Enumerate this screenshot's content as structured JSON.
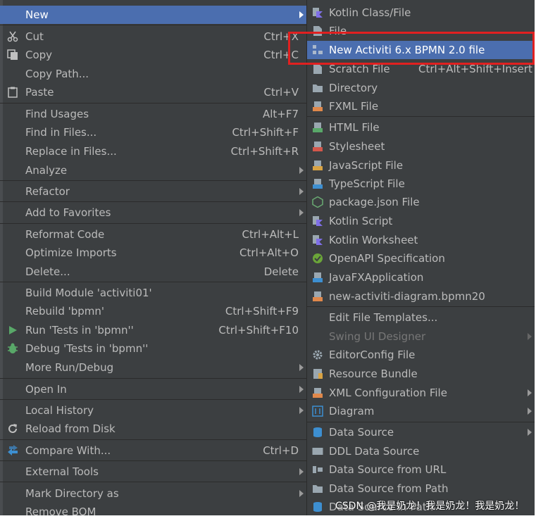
{
  "left_menu": [
    {
      "label": "New",
      "shortcut": "",
      "submenu": true,
      "highlight": true,
      "icon": ""
    },
    {
      "label": "Cut",
      "shortcut": "Ctrl+X",
      "icon": "scissors-icon"
    },
    {
      "label": "Copy",
      "shortcut": "Ctrl+C",
      "icon": "copy-icon"
    },
    {
      "label": "Copy Path...",
      "shortcut": "",
      "icon": ""
    },
    {
      "label": "Paste",
      "shortcut": "Ctrl+V",
      "icon": "clipboard-icon"
    },
    {
      "label": "Find Usages",
      "shortcut": "Alt+F7",
      "icon": ""
    },
    {
      "label": "Find in Files...",
      "shortcut": "Ctrl+Shift+F",
      "icon": ""
    },
    {
      "label": "Replace in Files...",
      "shortcut": "Ctrl+Shift+R",
      "icon": ""
    },
    {
      "label": "Analyze",
      "shortcut": "",
      "submenu": true,
      "icon": ""
    },
    {
      "label": "Refactor",
      "shortcut": "",
      "submenu": true,
      "icon": ""
    },
    {
      "label": "Add to Favorites",
      "shortcut": "",
      "submenu": true,
      "icon": ""
    },
    {
      "label": "Reformat Code",
      "shortcut": "Ctrl+Alt+L",
      "icon": ""
    },
    {
      "label": "Optimize Imports",
      "shortcut": "Ctrl+Alt+O",
      "icon": ""
    },
    {
      "label": "Delete...",
      "shortcut": "Delete",
      "icon": ""
    },
    {
      "label": "Build Module 'activiti01'",
      "shortcut": "",
      "icon": ""
    },
    {
      "label": "Rebuild 'bpmn'",
      "shortcut": "Ctrl+Shift+F9",
      "icon": ""
    },
    {
      "label": "Run 'Tests in 'bpmn''",
      "shortcut": "Ctrl+Shift+F10",
      "icon": "run-icon"
    },
    {
      "label": "Debug 'Tests in 'bpmn''",
      "shortcut": "",
      "icon": "debug-icon"
    },
    {
      "label": "More Run/Debug",
      "shortcut": "",
      "submenu": true,
      "icon": ""
    },
    {
      "label": "Open In",
      "shortcut": "",
      "submenu": true,
      "icon": ""
    },
    {
      "label": "Local History",
      "shortcut": "",
      "submenu": true,
      "icon": ""
    },
    {
      "label": "Reload from Disk",
      "shortcut": "",
      "icon": "reload-icon"
    },
    {
      "label": "Compare With...",
      "shortcut": "Ctrl+D",
      "icon": "compare-icon"
    },
    {
      "label": "External Tools",
      "shortcut": "",
      "submenu": true,
      "icon": ""
    },
    {
      "label": "Mark Directory as",
      "shortcut": "",
      "submenu": true,
      "icon": ""
    },
    {
      "label": "Remove BOM",
      "shortcut": "",
      "icon": ""
    }
  ],
  "right_menu": [
    {
      "label": "Kotlin Class/File",
      "icon": "kotlin-icon",
      "color": "#7f6fe8"
    },
    {
      "label": "File",
      "icon": "file-icon",
      "color": "#9aa7b0"
    },
    {
      "label": "New Activiti 6.x BPMN 2.0 file",
      "icon": "bpmn-icon",
      "color": "#8aa0c0",
      "highlight": true
    },
    {
      "label": "Scratch File",
      "shortcut": "Ctrl+Alt+Shift+Insert",
      "icon": "scratch-icon",
      "color": "#9aa7b0"
    },
    {
      "label": "Directory",
      "icon": "folder-icon",
      "color": "#9aa7b0"
    },
    {
      "label": "FXML File",
      "icon": "fxml-icon",
      "color": "#e0884b"
    },
    {
      "label": "HTML File",
      "icon": "html-icon",
      "color": "#59a869"
    },
    {
      "label": "Stylesheet",
      "icon": "css-icon",
      "color": "#d4574b"
    },
    {
      "label": "JavaScript File",
      "icon": "js-icon",
      "color": "#d9a343"
    },
    {
      "label": "TypeScript File",
      "icon": "ts-icon",
      "color": "#3d8fd1"
    },
    {
      "label": "package.json File",
      "icon": "nodejs-icon",
      "color": "#6aab73"
    },
    {
      "label": "Kotlin Script",
      "icon": "kotlin-script-icon",
      "color": "#7f6fe8"
    },
    {
      "label": "Kotlin Worksheet",
      "icon": "kotlin-worksheet-icon",
      "color": "#7f6fe8"
    },
    {
      "label": "OpenAPI Specification",
      "icon": "openapi-icon",
      "color": "#6ba539"
    },
    {
      "label": "JavaFXApplication",
      "icon": "javafx-icon",
      "color": "#3d8fd1"
    },
    {
      "label": "new-activiti-diagram.bpmn20",
      "icon": "bpmn-file-icon",
      "color": "#e0884b"
    },
    {
      "label": "Edit File Templates...",
      "icon": ""
    },
    {
      "label": "Swing UI Designer",
      "icon": "",
      "disabled": true,
      "submenu": true
    },
    {
      "label": "EditorConfig File",
      "icon": "gear-icon",
      "color": "#9aa7b0"
    },
    {
      "label": "Resource Bundle",
      "icon": "resource-bundle-icon",
      "color": "#d9a343"
    },
    {
      "label": "XML Configuration File",
      "icon": "xml-icon",
      "color": "#e0884b",
      "submenu": true
    },
    {
      "label": "Diagram",
      "icon": "diagram-icon",
      "color": "#3d8fd1",
      "submenu": true
    },
    {
      "label": "Data Source",
      "icon": "database-icon",
      "color": "#3d8fd1",
      "submenu": true
    },
    {
      "label": "DDL Data Source",
      "icon": "ddl-icon",
      "color": "#9aa7b0"
    },
    {
      "label": "Data Source from URL",
      "icon": "url-source-icon",
      "color": "#9aa7b0"
    },
    {
      "label": "Data Source from Path",
      "icon": "folder-source-icon",
      "color": "#9aa7b0"
    },
    {
      "label": "Data Source in Path",
      "icon": "database-path-icon",
      "color": "#3d8fd1"
    }
  ],
  "watermark": "CSDN @我是奶龙！我是奶龙！我是奶龙！"
}
